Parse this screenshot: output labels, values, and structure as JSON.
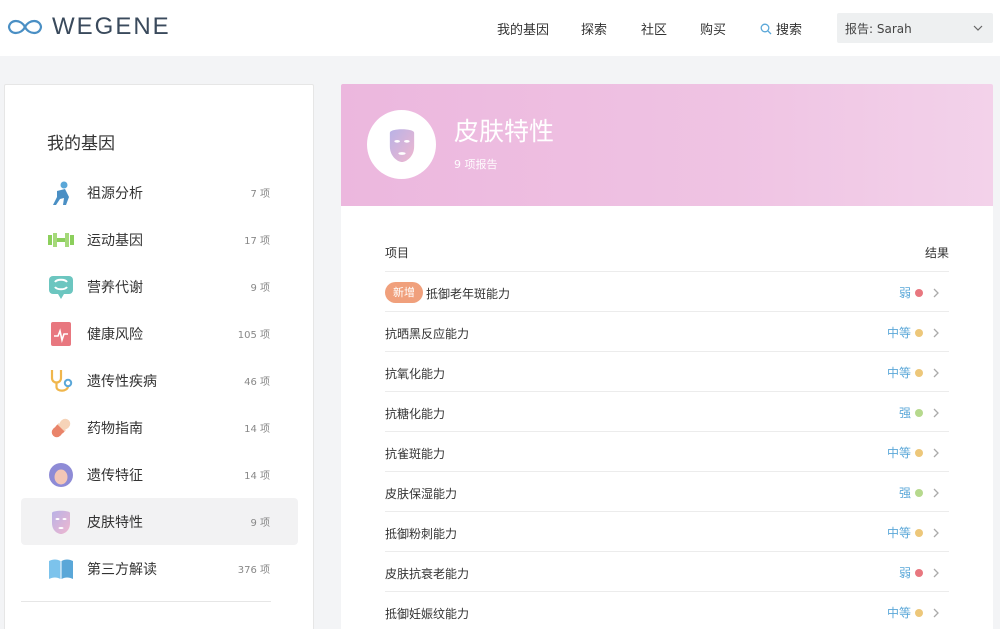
{
  "header": {
    "logo_text": "WEGENE",
    "nav": [
      "我的基因",
      "探索",
      "社区",
      "购买"
    ],
    "search_label": "搜索",
    "report_selector": "报告: Sarah"
  },
  "sidebar": {
    "title": "我的基因",
    "items": [
      {
        "label": "祖源分析",
        "count": "7 项",
        "icon": "ancestry-icon"
      },
      {
        "label": "运动基因",
        "count": "17 项",
        "icon": "dumbbell-icon"
      },
      {
        "label": "营养代谢",
        "count": "9 项",
        "icon": "nutrition-icon"
      },
      {
        "label": "健康风险",
        "count": "105 项",
        "icon": "health-risk-icon"
      },
      {
        "label": "遗传性疾病",
        "count": "46 项",
        "icon": "stethoscope-icon"
      },
      {
        "label": "药物指南",
        "count": "14 项",
        "icon": "pill-icon"
      },
      {
        "label": "遗传特征",
        "count": "14 项",
        "icon": "trait-icon"
      },
      {
        "label": "皮肤特性",
        "count": "9 项",
        "icon": "skin-mask-icon"
      },
      {
        "label": "第三方解读",
        "count": "376 项",
        "icon": "book-icon"
      }
    ]
  },
  "main": {
    "title": "皮肤特性",
    "subtitle": "9 项报告",
    "col_item": "项目",
    "col_result": "结果",
    "new_badge": "新增",
    "rows": [
      {
        "name": "抵御老年斑能力",
        "result": "弱",
        "level": "weak",
        "is_new": true
      },
      {
        "name": "抗晒黑反应能力",
        "result": "中等",
        "level": "medium",
        "is_new": false
      },
      {
        "name": "抗氧化能力",
        "result": "中等",
        "level": "medium",
        "is_new": false
      },
      {
        "name": "抗糖化能力",
        "result": "强",
        "level": "strong",
        "is_new": false
      },
      {
        "name": "抗雀斑能力",
        "result": "中等",
        "level": "medium",
        "is_new": false
      },
      {
        "name": "皮肤保湿能力",
        "result": "强",
        "level": "strong",
        "is_new": false
      },
      {
        "name": "抵御粉刺能力",
        "result": "中等",
        "level": "medium",
        "is_new": false
      },
      {
        "name": "皮肤抗衰老能力",
        "result": "弱",
        "level": "weak",
        "is_new": false
      },
      {
        "name": "抵御妊娠纹能力",
        "result": "中等",
        "level": "medium",
        "is_new": false
      }
    ]
  },
  "colors": {
    "result_text": "#5aa7d8",
    "dot_weak": "#e8777f",
    "dot_medium": "#edc77a",
    "dot_strong": "#b6d98d",
    "hero_pink": "#ecb7de",
    "new_badge": "#f0a07c"
  }
}
